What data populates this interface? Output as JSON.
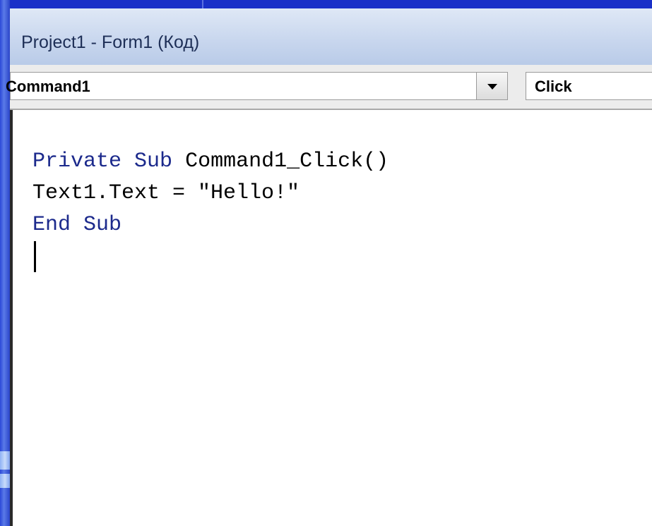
{
  "window": {
    "title": "Project1 - Form1 (Код)"
  },
  "toolbar": {
    "object_value": "Command1",
    "procedure_value": "Click"
  },
  "code": {
    "line1": {
      "kw1": "Private",
      "sp1": " ",
      "kw2": "Sub",
      "rest": " Command1_Click()"
    },
    "line2": "Text1.Text = \"Hello!\"",
    "line3": {
      "kw1": "End",
      "sp1": " ",
      "kw2": "Sub"
    }
  },
  "icons": {
    "dropdown": "chevron-down-icon"
  },
  "colors": {
    "keyword": "#1c2a8c",
    "titlebar": "#c9d7ee",
    "desktop": "#1b2fc4"
  }
}
